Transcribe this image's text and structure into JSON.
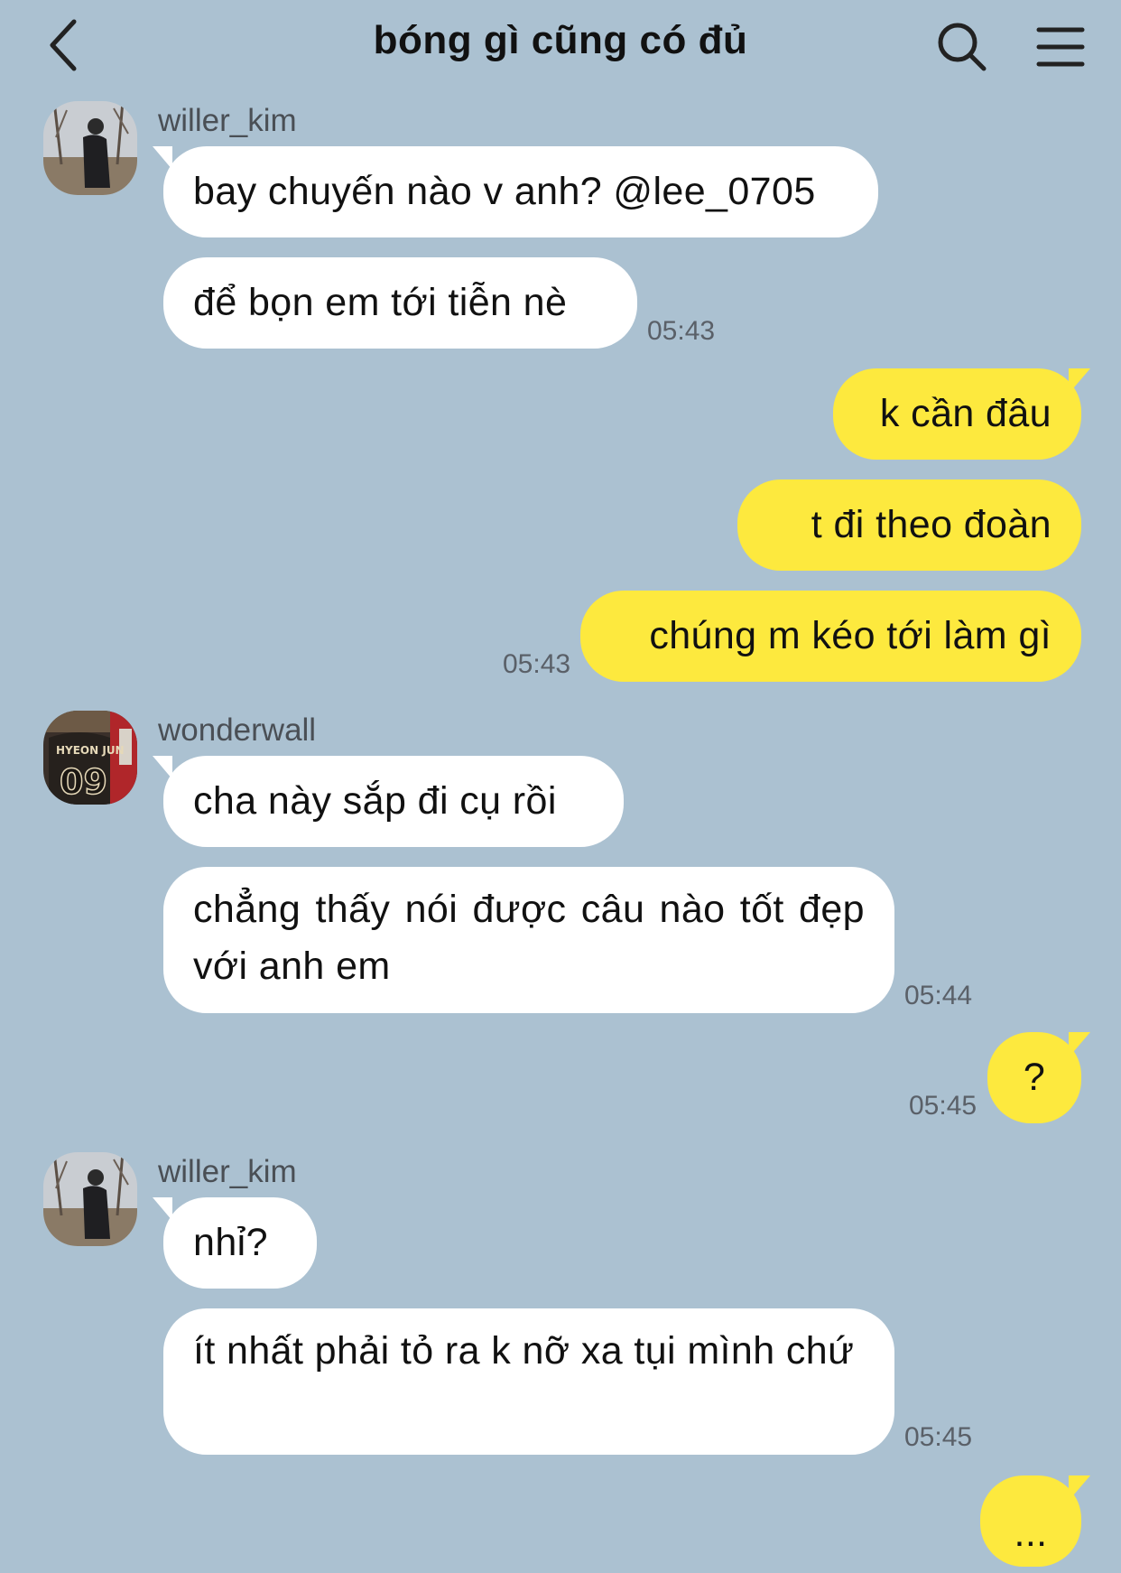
{
  "header": {
    "title": "bóng gì cũng có đủ",
    "back_icon": "chevron-left-icon",
    "search_icon": "search-icon",
    "menu_icon": "hamburger-menu-icon"
  },
  "colors": {
    "background": "#abc1d1",
    "incoming_bubble": "#ffffff",
    "outgoing_bubble": "#fde93e"
  },
  "messages": [
    {
      "sender": "willer_kim",
      "text": "bay chuyến nào v anh? @lee_0705"
    },
    {
      "sender": "willer_kim",
      "text": "để bọn em tới tiễn nè",
      "time": "05:43"
    },
    {
      "sender": "me",
      "text": "k cần đâu"
    },
    {
      "sender": "me",
      "text": "t đi theo đoàn"
    },
    {
      "sender": "me",
      "text": "chúng m kéo tới làm gì",
      "time": "05:43"
    },
    {
      "sender": "wonderwall",
      "text": "cha này sắp đi cụ rồi"
    },
    {
      "sender": "wonderwall",
      "text": "chẳng thấy nói được câu nào tốt đẹp với anh em",
      "time": "05:44"
    },
    {
      "sender": "me",
      "text": "?",
      "time": "05:45"
    },
    {
      "sender": "willer_kim",
      "text": "nhỉ?"
    },
    {
      "sender": "willer_kim",
      "text": "ít nhất phải tỏ ra k nỡ xa tụi mình chứ",
      "time": "05:45"
    },
    {
      "sender": "me",
      "text": "..."
    }
  ],
  "avatars": {
    "willer_kim": "person-photo-avatar",
    "wonderwall": "jersey-09-photo-avatar"
  }
}
